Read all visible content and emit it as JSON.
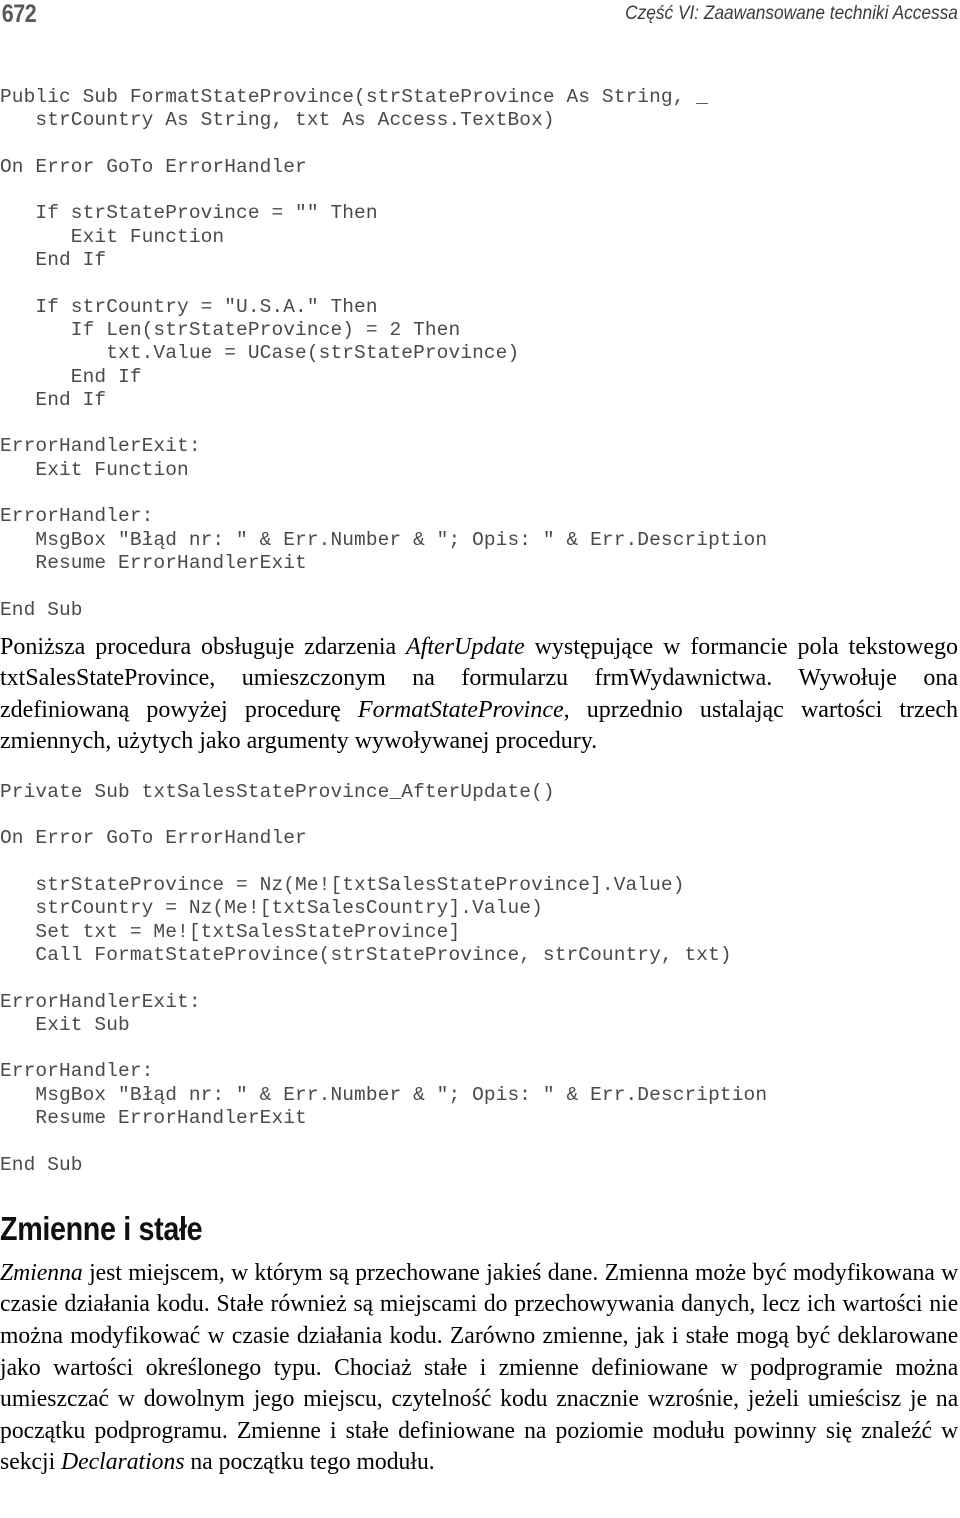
{
  "header": {
    "folio": "672",
    "running_title": "Część VI: Zaawansowane techniki Accessa"
  },
  "code_block_1": {
    "lines": [
      "Public Sub FormatStateProvince(strStateProvince As String, _",
      "   strCountry As String, txt As Access.TextBox)",
      "",
      "On Error GoTo ErrorHandler",
      "",
      "   If strStateProvince = \"\" Then",
      "      Exit Function",
      "   End If",
      "",
      "   If strCountry = \"U.S.A.\" Then",
      "      If Len(strStateProvince) = 2 Then",
      "         txt.Value = UCase(strStateProvince)",
      "      End If",
      "   End If",
      "",
      "ErrorHandlerExit:",
      "   Exit Function",
      "",
      "ErrorHandler:",
      "   MsgBox \"Błąd nr: \" & Err.Number & \"; Opis: \" & Err.Description",
      "   Resume ErrorHandlerExit",
      "",
      "End Sub"
    ]
  },
  "paragraph_1": {
    "segments": [
      {
        "text": "Poniższa procedura obsługuje zdarzenia ",
        "style": "normal"
      },
      {
        "text": "AfterUpdate",
        "style": "italic"
      },
      {
        "text": " występujące w formancie pola tekstowego txtSalesStateProvince, umieszczonym na formularzu frmWydawnictwa. Wywołuje ona zdefiniowaną powyżej procedurę ",
        "style": "normal"
      },
      {
        "text": "FormatStateProvince",
        "style": "italic"
      },
      {
        "text": ", uprzednio ustalając wartości trzech zmiennych, użytych jako argumenty wywoływanej procedury.",
        "style": "normal"
      }
    ]
  },
  "code_block_2": {
    "lines": [
      "Private Sub txtSalesStateProvince_AfterUpdate()",
      "",
      "On Error GoTo ErrorHandler",
      "",
      "   strStateProvince = Nz(Me![txtSalesStateProvince].Value)",
      "   strCountry = Nz(Me![txtSalesCountry].Value)",
      "   Set txt = Me![txtSalesStateProvince]",
      "   Call FormatStateProvince(strStateProvince, strCountry, txt)",
      "",
      "ErrorHandlerExit:",
      "   Exit Sub",
      "",
      "ErrorHandler:",
      "   MsgBox \"Błąd nr: \" & Err.Number & \"; Opis: \" & Err.Description",
      "   Resume ErrorHandlerExit",
      "",
      "End Sub"
    ]
  },
  "section_heading": {
    "title": "Zmienne i stałe"
  },
  "paragraph_2": {
    "segments": [
      {
        "text": "Zmienna",
        "style": "italic"
      },
      {
        "text": " jest miejscem, w którym są przechowane jakieś dane. Zmienna może być modyfikowana w czasie działania kodu. Stałe również są miejscami do przechowywania danych, lecz ich wartości nie można modyfikować w czasie działania kodu. Zarówno zmienne, jak i stałe mogą być deklarowane jako wartości określonego typu. Chociaż stałe i zmienne definiowane w podprogramie można umieszczać w dowolnym jego miejscu, czytelność kodu znacznie wzrośnie, jeżeli umieścisz je na początku podprogramu. Zmienne i stałe definiowane na poziomie modułu powinny się znaleźć w sekcji ",
        "style": "normal"
      },
      {
        "text": "Declarations",
        "style": "italic"
      },
      {
        "text": " na początku tego modułu.",
        "style": "normal"
      }
    ]
  },
  "colors": {
    "code_text": "#4a4a4a",
    "folio": "#58595b",
    "running_title": "#3c3c3c",
    "body_text": "#000000"
  }
}
